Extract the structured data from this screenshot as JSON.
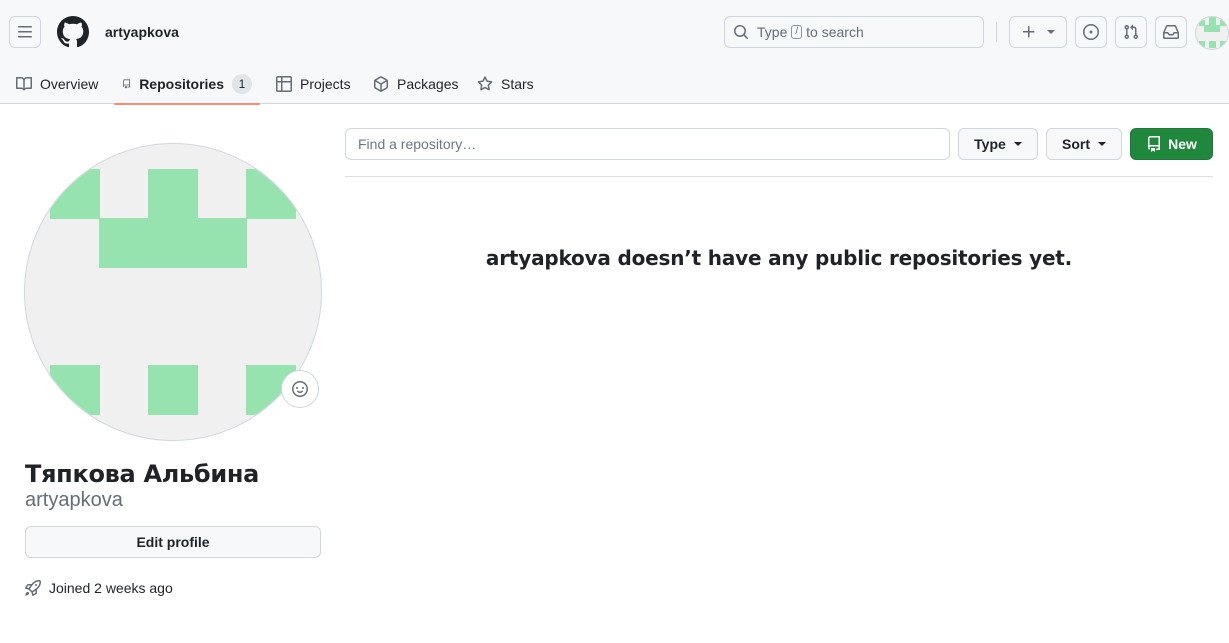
{
  "header": {
    "username": "artyapkova",
    "search": {
      "prefix": "Type",
      "key": "/",
      "suffix": "to search"
    }
  },
  "tabs": [
    {
      "label": "Overview",
      "icon": "book-icon"
    },
    {
      "label": "Repositories",
      "icon": "repo-icon",
      "count": "1"
    },
    {
      "label": "Projects",
      "icon": "table-icon"
    },
    {
      "label": "Packages",
      "icon": "package-icon"
    },
    {
      "label": "Stars",
      "icon": "star-icon"
    }
  ],
  "profile": {
    "full_name": "Тяпкова Альбина",
    "login": "artyapkova",
    "edit_label": "Edit profile",
    "joined": "Joined 2 weeks ago"
  },
  "repos": {
    "search_placeholder": "Find a repository…",
    "type_label": "Type",
    "sort_label": "Sort",
    "new_label": "New",
    "empty_message": "artyapkova doesn’t have any public repositories yet."
  },
  "colors": {
    "accent_tab": "#fd8c73",
    "new_button": "#1f883d",
    "identicon": "#97e3b0"
  }
}
